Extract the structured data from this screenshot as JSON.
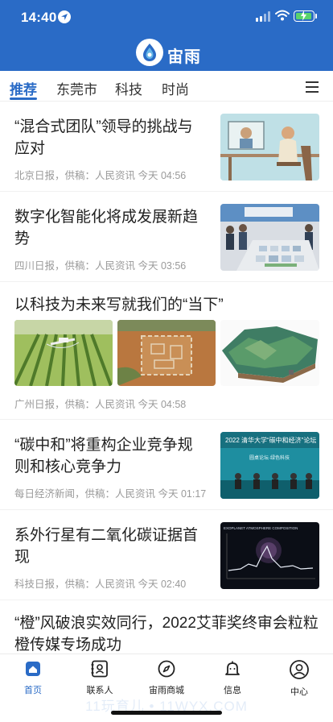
{
  "status_bar": {
    "time": "14:40"
  },
  "app": {
    "name": "宙雨"
  },
  "tabs": [
    {
      "label": "推荐",
      "active": true
    },
    {
      "label": "东莞市",
      "active": false
    },
    {
      "label": "科技",
      "active": false
    },
    {
      "label": "时尚",
      "active": false
    }
  ],
  "articles": [
    {
      "title": "“混合式团队”领导的挑战与应对",
      "meta": "北京日报，供稿：人民资讯  今天 04:56"
    },
    {
      "title": "数字化智能化将成发展新趋势",
      "meta": "四川日报，供稿：人民资讯  今天 03:56"
    },
    {
      "title": "以科技为未来写就我们的“当下”",
      "meta": "广州日报，供稿：人民资讯  今天 04:58"
    },
    {
      "title": "“碳中和”将重构企业竞争规则和核心竞争力",
      "meta": "每日经济新闻，供稿：人民资讯  今天 01:17"
    },
    {
      "title": "系外行星有二氧化碳证据首现",
      "meta": "科技日报，供稿：人民资讯  今天 02:40"
    },
    {
      "title": "“橙”风破浪实效同行，2022艾菲奖终审会粒粒橙传媒专场成功",
      "meta": ""
    }
  ],
  "thumbnails": {
    "forum_banner": "2022 清华大学“碳中和经济”论坛",
    "forum_subtitle": "圆桌论坛·绿色科技",
    "chart_label": "EXOPLANET ATMOSPHERE COMPOSITION"
  },
  "tabbar": [
    {
      "label": "首页",
      "icon": "home-icon",
      "active": true
    },
    {
      "label": "联系人",
      "icon": "contacts-icon",
      "active": false
    },
    {
      "label": "宙雨商城",
      "icon": "compass-icon",
      "active": false
    },
    {
      "label": "信息",
      "icon": "bell-icon",
      "active": false
    },
    {
      "label": "中心",
      "icon": "user-icon",
      "active": false
    }
  ],
  "watermark": "11玩育儿 • 11WYX.COM",
  "colors": {
    "brand": "#2a6bc6",
    "text": "#222222",
    "meta": "#9a9a9a"
  }
}
